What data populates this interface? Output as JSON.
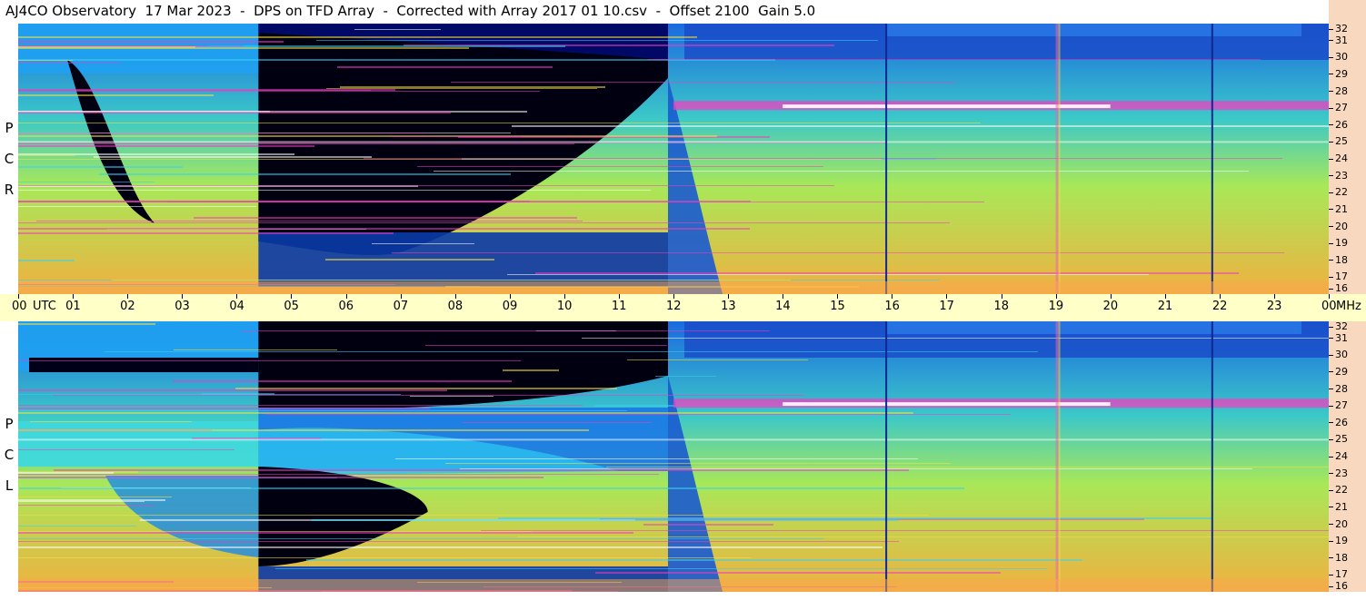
{
  "title": "AJ4CO Observatory  17 Mar 2023  -  DPS on TFD Array  -  Corrected with Array 2017 01 10.csv  -  Offset 2100  Gain 5.0",
  "panels": [
    {
      "id": "top",
      "label": [
        "R",
        "C",
        "P"
      ]
    },
    {
      "id": "bottom",
      "label": [
        "L",
        "C",
        "P"
      ]
    }
  ],
  "time_axis": {
    "labels": [
      "00",
      "UTC",
      "01",
      "02",
      "03",
      "04",
      "05",
      "06",
      "07",
      "08",
      "09",
      "10",
      "11",
      "12",
      "13",
      "14",
      "15",
      "16",
      "17",
      "18",
      "19",
      "20",
      "21",
      "22",
      "23",
      "00",
      "MHz"
    ]
  },
  "chart_data": {
    "type": "heatmap",
    "title": "AJ4CO Observatory  17 Mar 2023  -  DPS on TFD Array  -  Corrected with Array 2017 01 10.csv  -  Offset 2100  Gain 5.0",
    "x": {
      "label": "UTC",
      "ticks": [
        "00",
        "01",
        "02",
        "03",
        "04",
        "05",
        "06",
        "07",
        "08",
        "09",
        "10",
        "11",
        "12",
        "13",
        "14",
        "15",
        "16",
        "17",
        "18",
        "19",
        "20",
        "21",
        "22",
        "23",
        "00"
      ],
      "range_hours": [
        0,
        24
      ]
    },
    "y": {
      "label": "MHz",
      "ticks": [
        16,
        17,
        18,
        19,
        20,
        21,
        22,
        23,
        24,
        25,
        26,
        27,
        28,
        29,
        30,
        31,
        32
      ],
      "range": [
        16,
        32
      ]
    },
    "series": [
      {
        "name": "RCP",
        "description_colormap": "blue-cyan-green-yellow-magenta-white"
      },
      {
        "name": "LCP",
        "description_colormap": "blue-cyan-green-yellow-magenta-white"
      }
    ],
    "colors": {
      "low": "#000010",
      "mid_low": "#0a3aa8",
      "mid": "#1ec8e8",
      "mid_high": "#b8f040",
      "high": "#f8c020",
      "peak": "#f020a0"
    }
  }
}
